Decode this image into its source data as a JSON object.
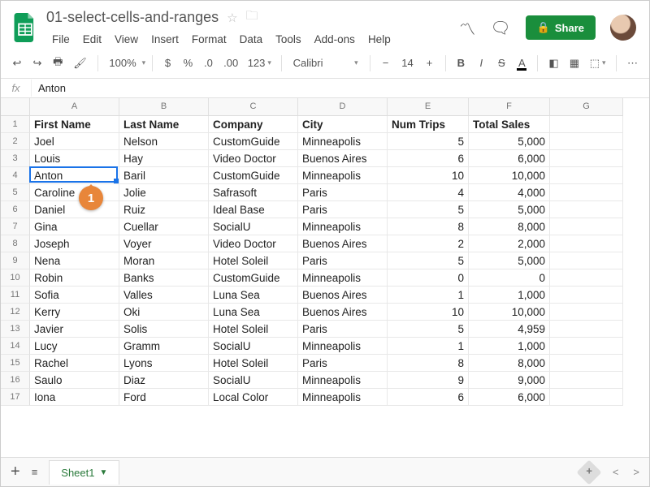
{
  "doc": {
    "title": "01-select-cells-and-ranges",
    "share_label": "Share"
  },
  "menus": [
    "File",
    "Edit",
    "View",
    "Insert",
    "Format",
    "Data",
    "Tools",
    "Add-ons",
    "Help"
  ],
  "toolbar": {
    "zoom": "100%",
    "formats": "123",
    "font": "Calibri",
    "size": "14"
  },
  "formula": {
    "value": "Anton",
    "active_cell_ref": "A4"
  },
  "columns": [
    "A",
    "B",
    "C",
    "D",
    "E",
    "F",
    "G"
  ],
  "headers": [
    "First Name",
    "Last Name",
    "Company",
    "City",
    "Num Trips",
    "Total Sales",
    ""
  ],
  "rows": [
    {
      "n": "2",
      "c": [
        "Joel",
        "Nelson",
        "CustomGuide",
        "Minneapolis",
        "5",
        "5,000",
        ""
      ]
    },
    {
      "n": "3",
      "c": [
        "Louis",
        "Hay",
        "Video Doctor",
        "Buenos Aires",
        "6",
        "6,000",
        ""
      ]
    },
    {
      "n": "4",
      "c": [
        "Anton",
        "Baril",
        "CustomGuide",
        "Minneapolis",
        "10",
        "10,000",
        ""
      ]
    },
    {
      "n": "5",
      "c": [
        "Caroline",
        "Jolie",
        "Safrasoft",
        "Paris",
        "4",
        "4,000",
        ""
      ]
    },
    {
      "n": "6",
      "c": [
        "Daniel",
        "Ruiz",
        "Ideal Base",
        "Paris",
        "5",
        "5,000",
        ""
      ]
    },
    {
      "n": "7",
      "c": [
        "Gina",
        "Cuellar",
        "SocialU",
        "Minneapolis",
        "8",
        "8,000",
        ""
      ]
    },
    {
      "n": "8",
      "c": [
        "Joseph",
        "Voyer",
        "Video Doctor",
        "Buenos Aires",
        "2",
        "2,000",
        ""
      ]
    },
    {
      "n": "9",
      "c": [
        "Nena",
        "Moran",
        "Hotel Soleil",
        "Paris",
        "5",
        "5,000",
        ""
      ]
    },
    {
      "n": "10",
      "c": [
        "Robin",
        "Banks",
        "CustomGuide",
        "Minneapolis",
        "0",
        "0",
        ""
      ]
    },
    {
      "n": "11",
      "c": [
        "Sofia",
        "Valles",
        "Luna Sea",
        "Buenos Aires",
        "1",
        "1,000",
        ""
      ]
    },
    {
      "n": "12",
      "c": [
        "Kerry",
        "Oki",
        "Luna Sea",
        "Buenos Aires",
        "10",
        "10,000",
        ""
      ]
    },
    {
      "n": "13",
      "c": [
        "Javier",
        "Solis",
        "Hotel Soleil",
        "Paris",
        "5",
        "4,959",
        ""
      ]
    },
    {
      "n": "14",
      "c": [
        "Lucy",
        "Gramm",
        "SocialU",
        "Minneapolis",
        "1",
        "1,000",
        ""
      ]
    },
    {
      "n": "15",
      "c": [
        "Rachel",
        "Lyons",
        "Hotel Soleil",
        "Paris",
        "8",
        "8,000",
        ""
      ]
    },
    {
      "n": "16",
      "c": [
        "Saulo",
        "Diaz",
        "SocialU",
        "Minneapolis",
        "9",
        "9,000",
        ""
      ]
    },
    {
      "n": "17",
      "c": [
        "Iona",
        "Ford",
        "Local Color",
        "Minneapolis",
        "6",
        "6,000",
        ""
      ]
    }
  ],
  "callout": {
    "label": "1"
  },
  "sheet": {
    "name": "Sheet1"
  }
}
